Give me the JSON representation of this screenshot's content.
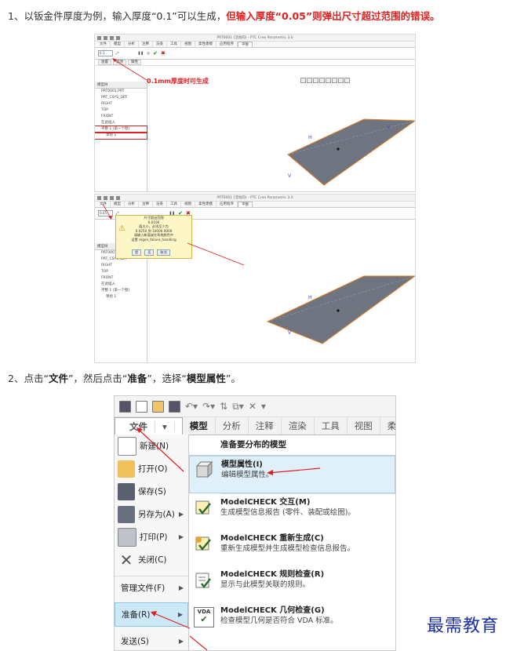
{
  "step1": {
    "prefix": "1、以钣金件厚度为例，输入厚度“0.1”可以生成，",
    "red": "但输入厚度“0.05”则弹出尺寸超过范围的错误。"
  },
  "shot1": {
    "title": "PRT0001 (活动的) - PTC Creo Parametric 3.0",
    "ribbon_tabs": [
      "文件",
      "模型",
      "分析",
      "注释",
      "渲染",
      "工具",
      "视图",
      "柔性建模",
      "应用程序",
      "平整"
    ],
    "active_tab": "平整",
    "thickness_value": "0.1",
    "sub_tabs": [
      "放置",
      "选项",
      "属性"
    ],
    "callout": "0.1mm厚度时可生成",
    "tree_header": "模型树",
    "tree_items": [
      "PRT0001.PRT",
      "PRT_CSYS_DEF",
      "RIGHT",
      "TOP",
      "FRONT",
      "在此插入",
      "平整 1 (第一个壁)",
      "草绘 1"
    ]
  },
  "shot2": {
    "title": "PRT0001 (活动的) - PTC Creo Parametric 3.0",
    "ribbon_tabs": [
      "文件",
      "模型",
      "分析",
      "注释",
      "渲染",
      "工具",
      "视图",
      "柔性建模",
      "应用程序",
      "平整"
    ],
    "active_tab": "平整",
    "thickness_value": "0.05",
    "warning_lines": [
      "尺寸超出范围",
      "0.0100",
      "值太小，必须至少为",
      "0.0250 到 10000.0000",
      "请输入新值或在系统颜色中",
      "设置 regen_failure_handling"
    ],
    "warning_buttons": [
      "是",
      "否",
      "取消"
    ],
    "tree_header": "模型树",
    "tree_items": [
      "PRT0001.PRT",
      "PRT_CSYS_DEF",
      "RIGHT",
      "TOP",
      "FRONT",
      "在此插入",
      "平整 1 (第一个壁)",
      "草绘 1"
    ]
  },
  "step2": {
    "t1": "2、点击“",
    "file": "文件",
    "t2": "”，然后点击“",
    "prep": "准备",
    "t3": "”，选择“",
    "props": "模型属性",
    "t4": "”。"
  },
  "menu": {
    "tabs": [
      "文件",
      "模型",
      "分析",
      "注释",
      "渲染",
      "工具",
      "视图",
      "柔性建模"
    ],
    "file_arrow": "▾",
    "left_items": [
      {
        "label": "新建(N)",
        "icon": "new-icon"
      },
      {
        "label": "打开(O)",
        "icon": "folder-icon"
      },
      {
        "label": "保存(S)",
        "icon": "save-icon"
      },
      {
        "label": "另存为(A)",
        "icon": "saveas-icon",
        "submenu": true
      },
      {
        "label": "打印(P)",
        "icon": "print-icon",
        "submenu": true
      },
      {
        "label": "关闭(C)",
        "icon": "close-icon"
      },
      {
        "label": "管理文件(F)",
        "submenu": true
      },
      {
        "label": "准备(R)",
        "submenu": true,
        "highlight": true
      },
      {
        "label": "发送(S)",
        "submenu": true
      }
    ],
    "right_header": "准备要分布的模型",
    "right_items": [
      {
        "title": "模型属性(I)",
        "desc": "编辑模型属性。",
        "highlight": true
      },
      {
        "title": "ModelCHECK 交互(M)",
        "desc": "生成模型信息报告 (零件、装配或绘图)。"
      },
      {
        "title": "ModelCHECK 重新生成(C)",
        "desc": "重新生成模型并生成模型检查信息报告。"
      },
      {
        "title": "ModelCHECK 规则检查(R)",
        "desc": "显示与此模型关联的规则。"
      },
      {
        "title": "ModelCHECK 几何检查(G)",
        "desc": "检查模型几何是否符合 VDA 标准。"
      }
    ],
    "vda_label": "VDA"
  },
  "watermark": "最需教育",
  "colors": {
    "accent_red": "#e02020",
    "plate": "#6e7480",
    "highlight_blue": "#cde8f7",
    "watermark": "#1a2ea6"
  }
}
